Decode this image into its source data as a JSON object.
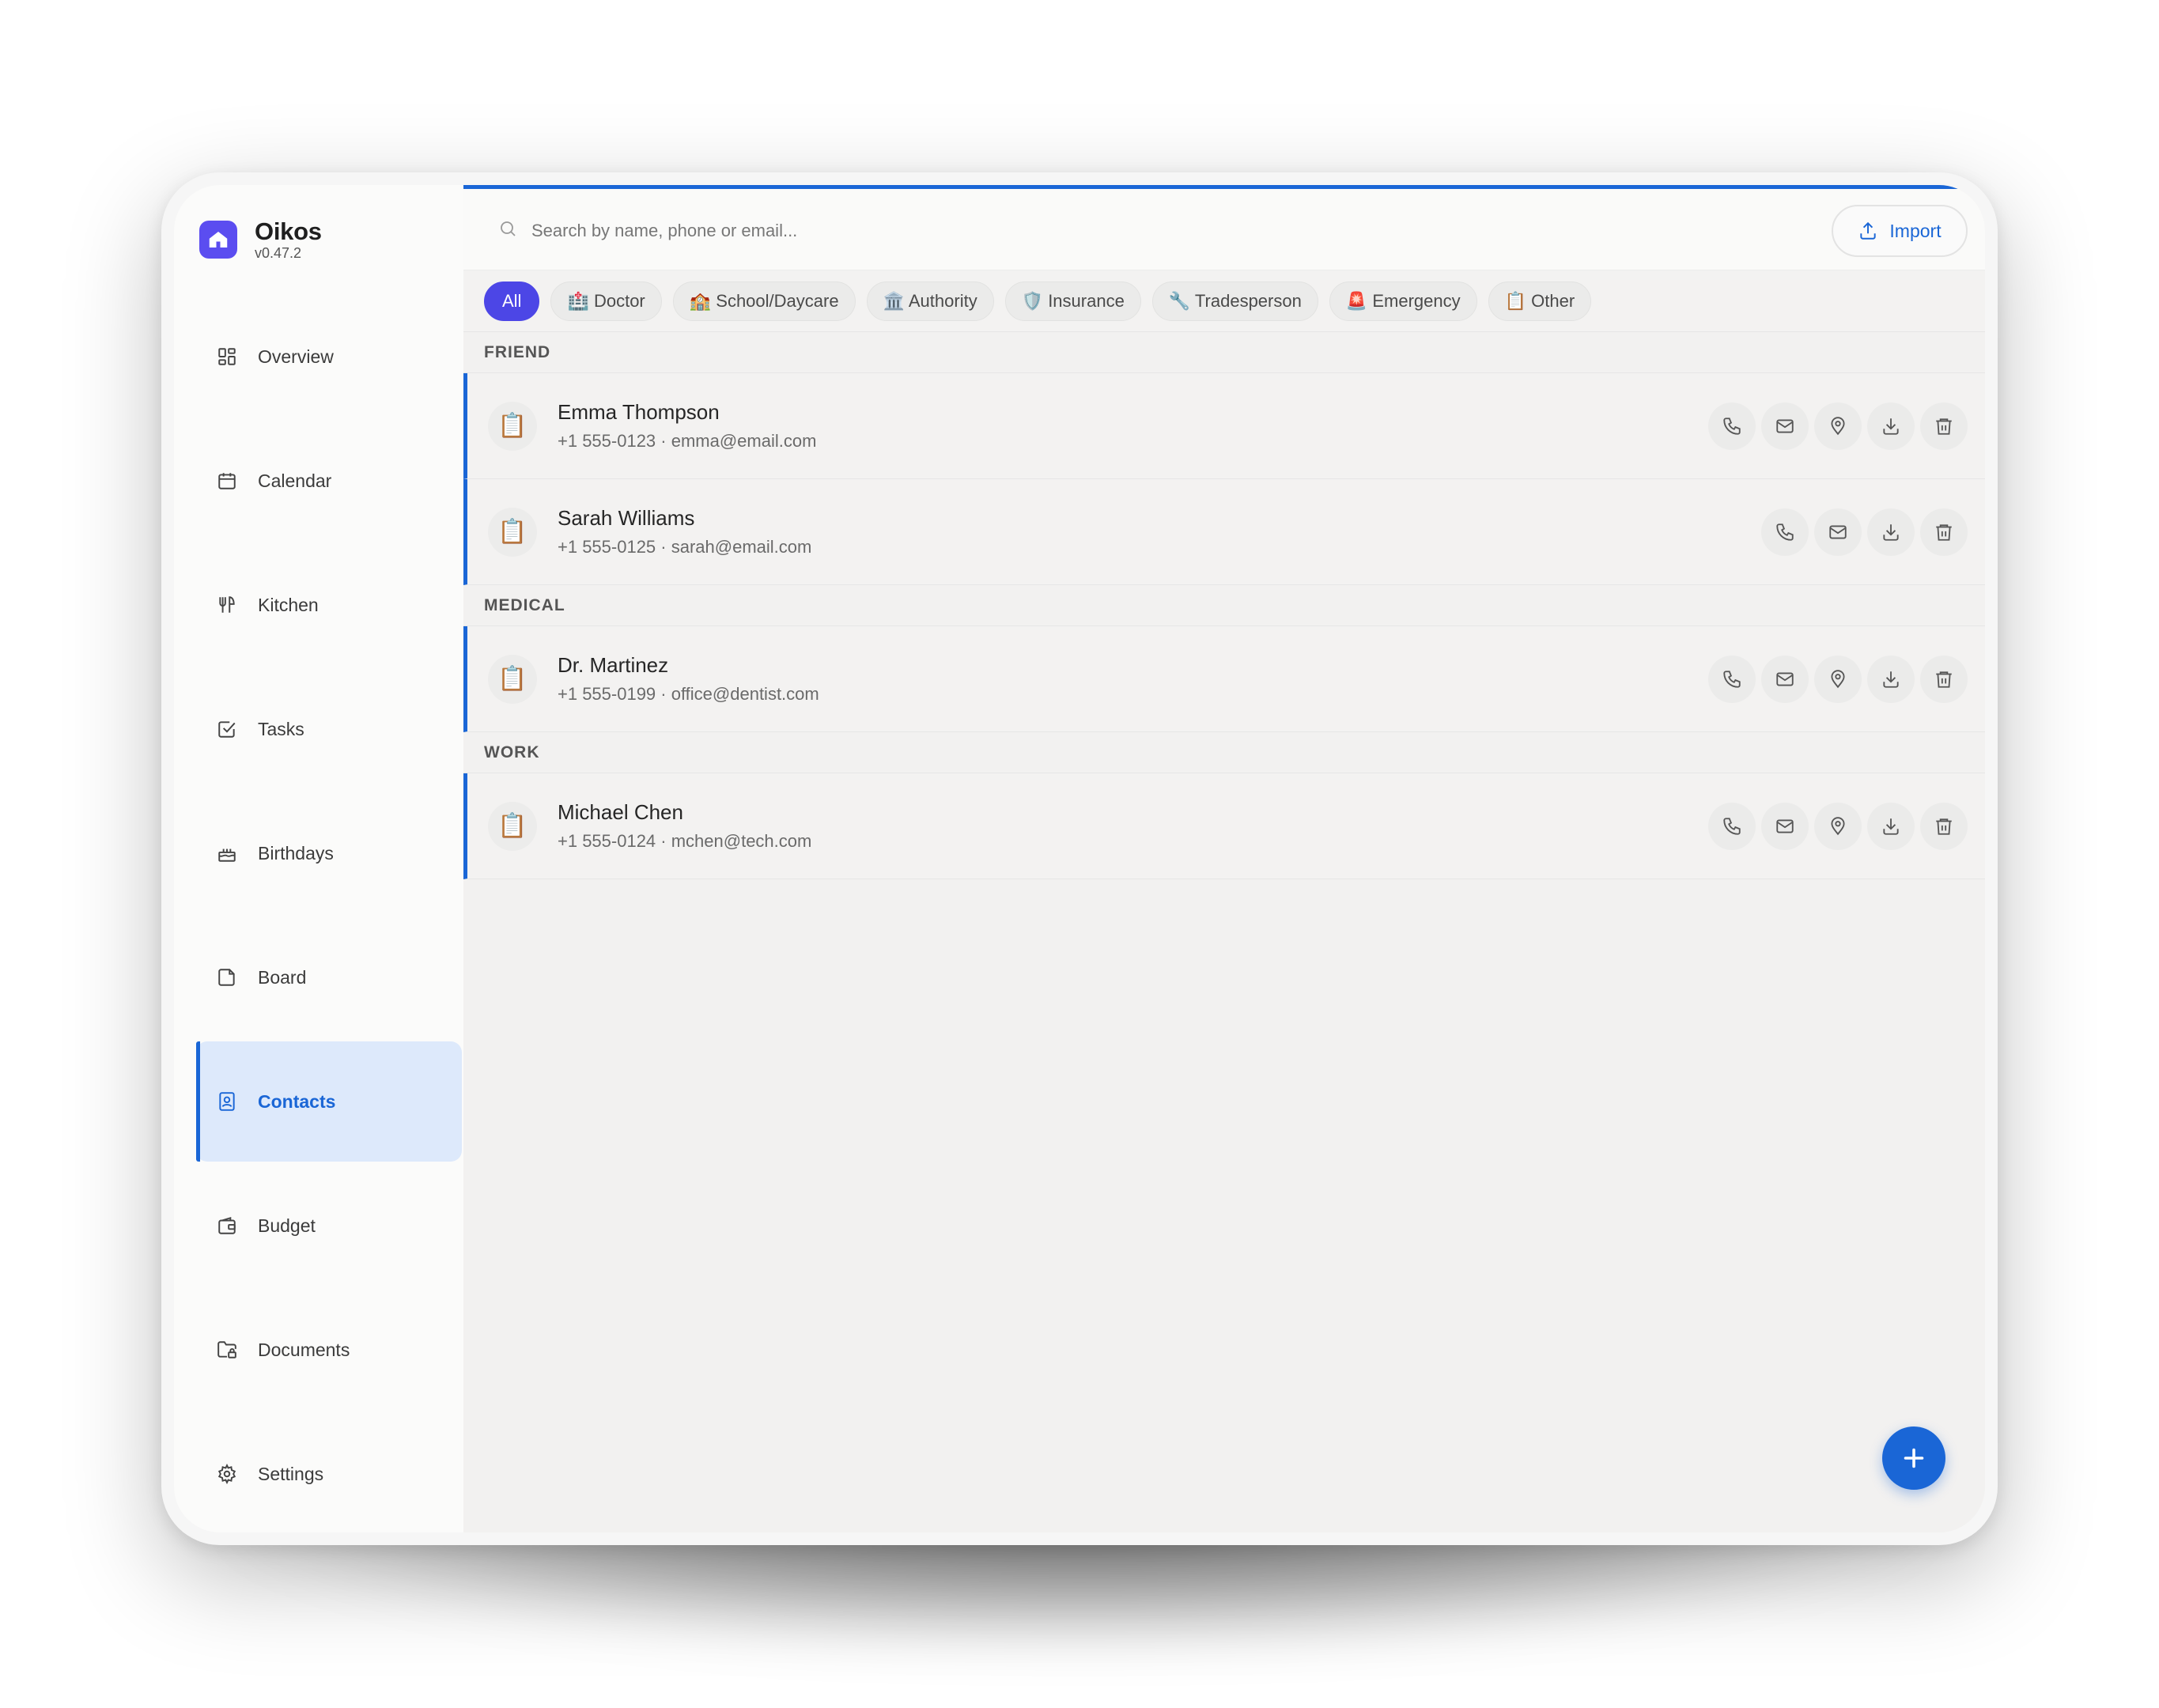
{
  "app": {
    "name": "Oikos",
    "version": "v0.47.2"
  },
  "sidebar": {
    "items": [
      {
        "label": "Overview",
        "icon": "grid-icon"
      },
      {
        "label": "Calendar",
        "icon": "calendar-icon"
      },
      {
        "label": "Kitchen",
        "icon": "utensils-icon"
      },
      {
        "label": "Tasks",
        "icon": "checkbox-icon"
      },
      {
        "label": "Birthdays",
        "icon": "cake-icon"
      },
      {
        "label": "Board",
        "icon": "note-icon"
      },
      {
        "label": "Contacts",
        "icon": "contact-book-icon",
        "active": true
      },
      {
        "label": "Budget",
        "icon": "wallet-icon"
      },
      {
        "label": "Documents",
        "icon": "folder-lock-icon"
      },
      {
        "label": "Settings",
        "icon": "gear-icon"
      }
    ]
  },
  "search": {
    "placeholder": "Search by name, phone or email..."
  },
  "import": {
    "label": "Import"
  },
  "filters": [
    {
      "label": "All",
      "active": true
    },
    {
      "label": "🏥 Doctor"
    },
    {
      "label": "🏫 School/Daycare"
    },
    {
      "label": "🏛️ Authority"
    },
    {
      "label": "🛡️ Insurance"
    },
    {
      "label": "🔧 Tradesperson"
    },
    {
      "label": "🚨 Emergency"
    },
    {
      "label": "📋 Other"
    }
  ],
  "groups": [
    {
      "label": "FRIEND",
      "contacts": [
        {
          "avatar": "📋",
          "name": "Emma Thompson",
          "meta": "+1 555-0123 · emma@email.com",
          "has_address": true
        },
        {
          "avatar": "📋",
          "name": "Sarah Williams",
          "meta": "+1 555-0125 · sarah@email.com",
          "has_address": false
        }
      ]
    },
    {
      "label": "MEDICAL",
      "contacts": [
        {
          "avatar": "📋",
          "name": "Dr. Martinez",
          "meta": "+1 555-0199 · office@dentist.com",
          "has_address": true
        }
      ]
    },
    {
      "label": "WORK",
      "contacts": [
        {
          "avatar": "📋",
          "name": "Michael Chen",
          "meta": "+1 555-0124 · mchen@tech.com",
          "has_address": true
        }
      ]
    }
  ],
  "colors": {
    "accent": "#1a66d6",
    "brand": "#5b4df0",
    "chip_active": "#4c46e6"
  }
}
